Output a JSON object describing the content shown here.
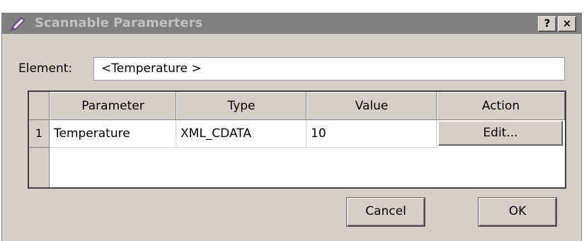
{
  "window": {
    "title": "Scannable Paramerters",
    "help_label": "?",
    "close_label": "×",
    "icon": "pencil-icon"
  },
  "element": {
    "label": "Element:",
    "value": "<Temperature >"
  },
  "table": {
    "columns": [
      "Parameter",
      "Type",
      "Value",
      "Action"
    ],
    "rows": [
      {
        "index": "1",
        "parameter": "Temperature",
        "type": "XML_CDATA",
        "value": "10",
        "action": "Edit..."
      }
    ]
  },
  "buttons": {
    "cancel": "Cancel",
    "ok": "OK"
  }
}
